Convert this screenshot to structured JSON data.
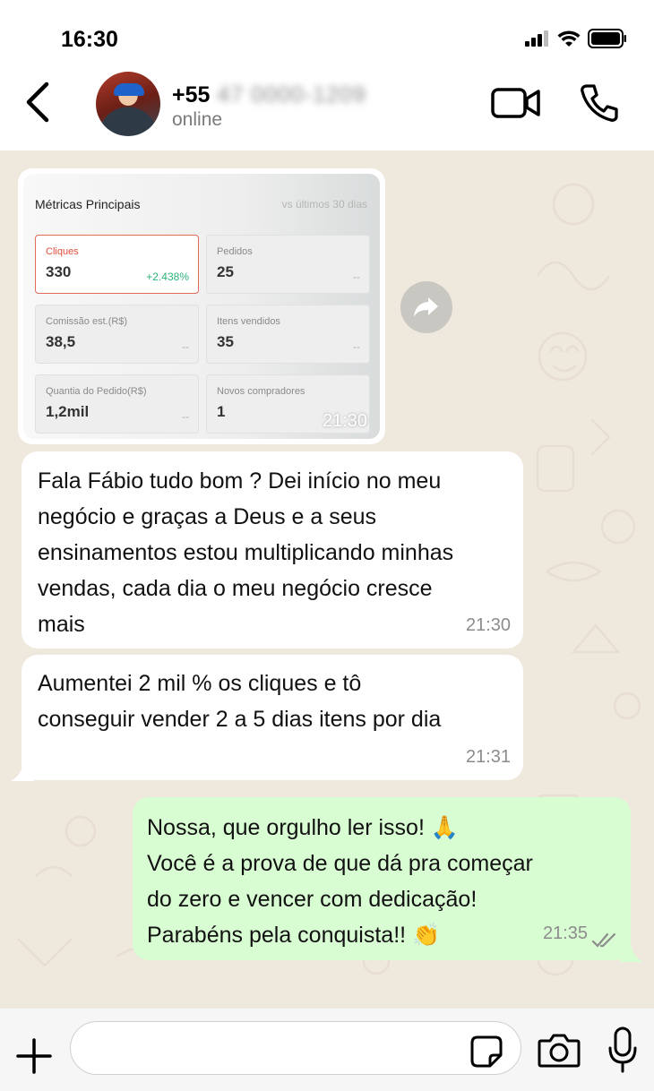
{
  "status_bar": {
    "time": "16:30"
  },
  "header": {
    "contact_prefix": "+55",
    "contact_hidden": "47 0000-1209",
    "status": "online"
  },
  "image_message": {
    "title": "Métricas Principais",
    "subtitle": "vs últimos 30 dias",
    "cards": [
      {
        "label": "Cliques",
        "value": "330",
        "delta": "+2.438%"
      },
      {
        "label": "Pedidos",
        "value": "25",
        "delta": "--"
      },
      {
        "label": "Comissão est.(R$)",
        "value": "38,5",
        "delta": "--"
      },
      {
        "label": "Itens vendidos",
        "value": "35",
        "delta": "--"
      },
      {
        "label": "Quantia do Pedido(R$)",
        "value": "1,2mil",
        "delta": "--"
      },
      {
        "label": "Novos compradores",
        "value": "1",
        "delta": ""
      }
    ],
    "time": "21:30"
  },
  "messages": [
    {
      "direction": "incoming",
      "lines": [
        "Fala Fábio tudo bom ? Dei início no meu",
        "negócio e graças a Deus e a seus",
        "ensinamentos estou multiplicando minhas",
        "vendas, cada dia o meu negócio cresce",
        "mais"
      ],
      "time": "21:30"
    },
    {
      "direction": "incoming",
      "lines": [
        "Aumentei 2 mil % os cliques e tô",
        "conseguir vender 2 a 5 dias itens por dia"
      ],
      "time": "21:31"
    },
    {
      "direction": "outgoing",
      "lines": [
        "Nossa, que orgulho ler isso! 🙏",
        "Você é a prova de que dá pra começar",
        "do zero e vencer com dedicação!",
        "Parabéns pela conquista!! 👏"
      ],
      "time": "21:35"
    }
  ],
  "composer": {
    "placeholder": ""
  },
  "colors": {
    "incoming": "#ffffff",
    "outgoing": "#d9fdd3",
    "chat_bg": "#efe8dd",
    "delta_green": "#2db37a",
    "active_border": "#e26b5a"
  },
  "icons": [
    "back-arrow-icon",
    "video-call-icon",
    "phone-icon",
    "forward-icon",
    "plus-icon",
    "sticker-icon",
    "camera-icon",
    "mic-icon",
    "double-check-icon"
  ]
}
